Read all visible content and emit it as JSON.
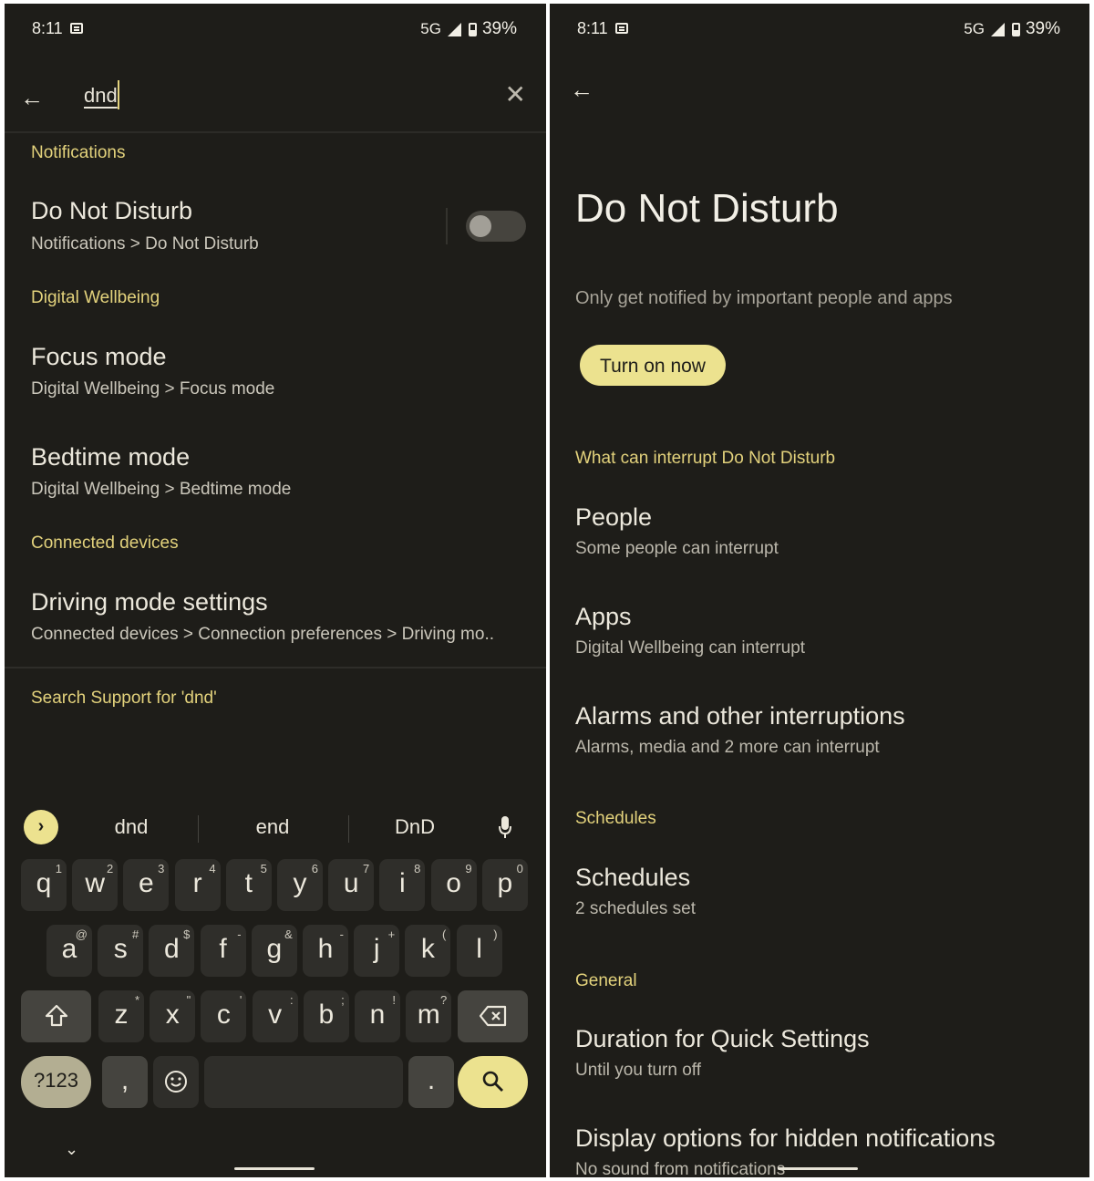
{
  "status_bar": {
    "time": "8:11",
    "network": "5G",
    "battery": "39%"
  },
  "search_screen": {
    "query": "dnd",
    "results": [
      {
        "section": "Notifications",
        "title": "Do Not Disturb",
        "path": "Notifications > Do Not Disturb",
        "toggle_on": false
      },
      {
        "section": "Digital Wellbeing",
        "title": "Focus mode",
        "path": "Digital Wellbeing > Focus mode"
      },
      {
        "title": "Bedtime mode",
        "path": "Digital Wellbeing > Bedtime mode"
      },
      {
        "section": "Connected devices",
        "title": "Driving mode settings",
        "path": "Connected devices > Connection preferences > Driving mo.."
      }
    ],
    "support_link": "Search Support for 'dnd'"
  },
  "keyboard": {
    "suggestions": [
      "dnd",
      "end",
      "DnD"
    ],
    "row1": [
      [
        "q",
        "1"
      ],
      [
        "w",
        "2"
      ],
      [
        "e",
        "3"
      ],
      [
        "r",
        "4"
      ],
      [
        "t",
        "5"
      ],
      [
        "y",
        "6"
      ],
      [
        "u",
        "7"
      ],
      [
        "i",
        "8"
      ],
      [
        "o",
        "9"
      ],
      [
        "p",
        "0"
      ]
    ],
    "row2": [
      [
        "a",
        "@"
      ],
      [
        "s",
        "#"
      ],
      [
        "d",
        "$"
      ],
      [
        "f",
        "-"
      ],
      [
        "g",
        "&"
      ],
      [
        "h",
        "-"
      ],
      [
        "j",
        "+"
      ],
      [
        "k",
        "("
      ],
      [
        "l",
        ")"
      ]
    ],
    "row3": [
      [
        "z",
        "*"
      ],
      [
        "x",
        "\""
      ],
      [
        "c",
        "'"
      ],
      [
        "v",
        ":"
      ],
      [
        "b",
        ";"
      ],
      [
        "n",
        "!"
      ],
      [
        "m",
        "?"
      ]
    ],
    "symbols_label": "?123",
    "comma": ",",
    "period": "."
  },
  "dnd_screen": {
    "title": "Do Not Disturb",
    "description": "Only get notified by important people and apps",
    "turn_on_label": "Turn on now",
    "sections": [
      {
        "header": "What can interrupt Do Not Disturb",
        "items": [
          {
            "title": "People",
            "subtitle": "Some people can interrupt"
          },
          {
            "title": "Apps",
            "subtitle": "Digital Wellbeing can interrupt"
          },
          {
            "title": "Alarms and other interruptions",
            "subtitle": "Alarms, media and 2 more can interrupt"
          }
        ]
      },
      {
        "header": "Schedules",
        "items": [
          {
            "title": "Schedules",
            "subtitle": "2 schedules set"
          }
        ]
      },
      {
        "header": "General",
        "items": [
          {
            "title": "Duration for Quick Settings",
            "subtitle": "Until you turn off"
          },
          {
            "title": "Display options for hidden notifications",
            "subtitle": "No sound from notifications"
          }
        ]
      }
    ]
  },
  "colors": {
    "background": "#1e1d19",
    "accent": "#e3d27c",
    "button": "#ece28f"
  }
}
